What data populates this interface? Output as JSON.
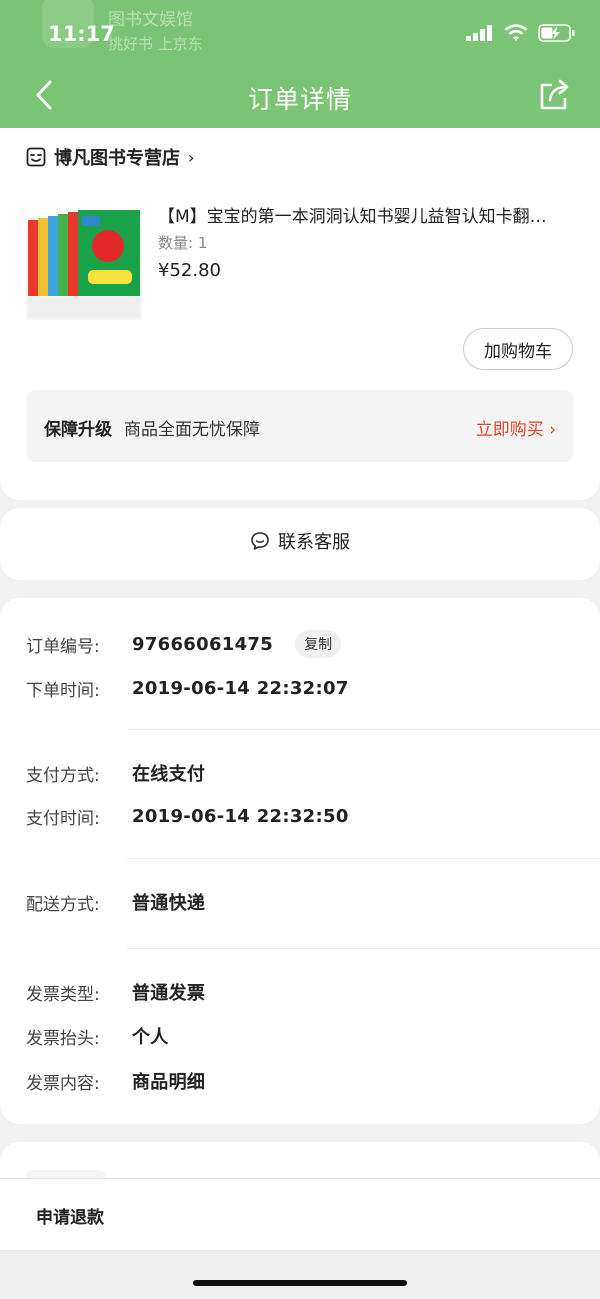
{
  "status_bar": {
    "time": "11:17",
    "ghost_app_name": "图书文娱馆",
    "ghost_app_subtitle": "挑好书 上京东"
  },
  "header": {
    "title": "订单详情",
    "back_icon": "chevron-left-icon",
    "share_icon": "share-icon",
    "bg_color": "#7cc475"
  },
  "shop": {
    "name": "博凡图书专营店",
    "arrow": "›",
    "icon": "shop-icon"
  },
  "product": {
    "title": "【M】宝宝的第一本洞洞认知书婴儿益智认知卡翻…",
    "qty": "数量: 1",
    "price": "¥52.80",
    "image_icon": "book-set-thumbnail"
  },
  "actions": {
    "add_to_cart": "加购物车"
  },
  "guarantee": {
    "label": "保障升级",
    "desc": "商品全面无忧保障",
    "buy": "立即购买 ›",
    "accent_color": "#e2452b"
  },
  "service": {
    "contact": "联系客服",
    "icon": "chat-bubble-icon"
  },
  "order": {
    "number_label": "订单编号:",
    "number": "97666061475",
    "copy": "复制",
    "order_time_label": "下单时间:",
    "order_time": "2019-06-14 22:32:07",
    "pay_method_label": "支付方式:",
    "pay_method": "在线支付",
    "pay_time_label": "支付时间:",
    "pay_time": "2019-06-14 22:32:50",
    "delivery_label": "配送方式:",
    "delivery": "普通快递",
    "invoice_type_label": "发票类型:",
    "invoice_type": "普通发票",
    "invoice_title_label": "发票抬头:",
    "invoice_title": "个人",
    "invoice_content_label": "发票内容:",
    "invoice_content": "商品明细"
  },
  "bottom_bar": {
    "refund": "申请退款"
  }
}
